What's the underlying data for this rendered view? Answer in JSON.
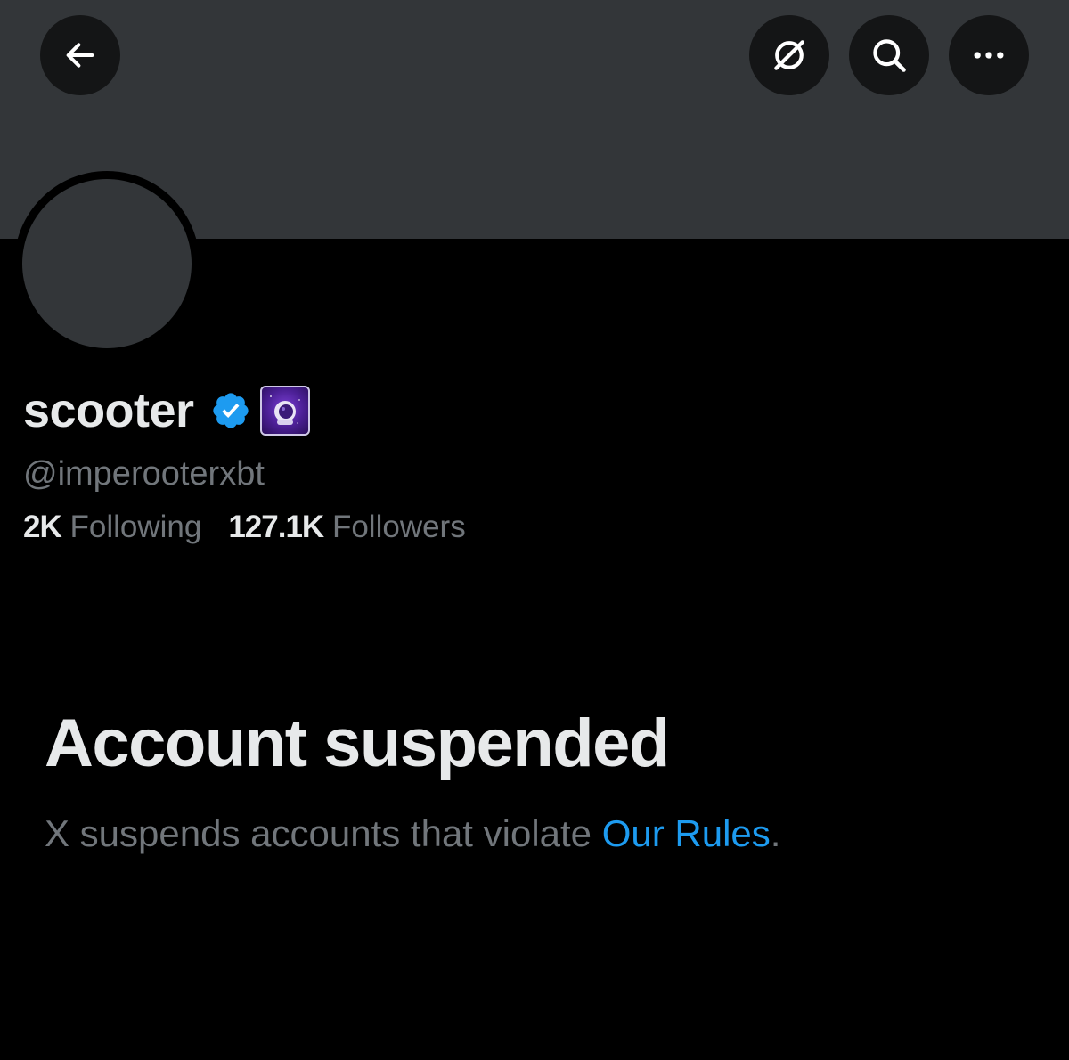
{
  "header": {
    "back_icon": "arrow-left-icon",
    "grok_icon": "grok-slash-circle-icon",
    "search_icon": "search-icon",
    "more_icon": "more-dots-icon"
  },
  "profile": {
    "display_name": "scooter",
    "verified_icon": "verified-badge-icon",
    "affiliate_icon": "astronaut-badge-icon",
    "handle": "@imperooterxbt",
    "following_count": "2K",
    "following_label": "Following",
    "followers_count": "127.1K",
    "followers_label": "Followers"
  },
  "suspension": {
    "title": "Account suspended",
    "description_prefix": "X suspends accounts that violate ",
    "rules_link": "Our Rules",
    "description_suffix": "."
  },
  "colors": {
    "background": "#000000",
    "banner": "#333639",
    "primary_text": "#e7e9ea",
    "secondary_text": "#71767b",
    "link": "#1d9bf0",
    "verified": "#1d9bf0"
  }
}
